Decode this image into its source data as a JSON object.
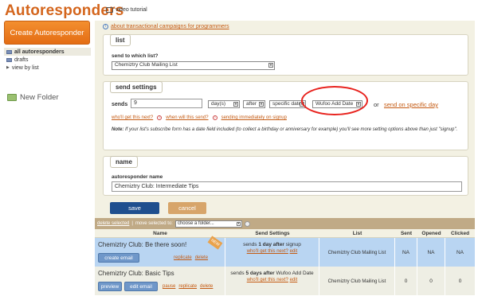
{
  "page": {
    "title": "Autoresponders",
    "video_tutorial": "video tutorial"
  },
  "sidebar": {
    "create_button": "Create Autoresponder",
    "items": [
      {
        "label": "all autoresponders"
      },
      {
        "label": "drafts"
      },
      {
        "label": "view by list"
      }
    ],
    "new_folder": "New Folder"
  },
  "main": {
    "info_link": "about transactional campaigns for programmers",
    "list_section": {
      "heading": "list",
      "field_label": "send to which list?",
      "selected_list": "Chemiztry Club Mailing List"
    },
    "send_settings": {
      "heading": "send settings",
      "sends_label": "sends",
      "sends_value": "9",
      "unit": "day(s)",
      "relation": "after",
      "anchor": "specific date",
      "date_field": "Wufoo Add Date",
      "or_text": "or",
      "specific_day_link": "send on specific day",
      "who_link": "who'll get this next?",
      "when_link": "when will this send?",
      "immediate_link": "sending immediately on signup",
      "note_label": "Note:",
      "note_text": "If your list's subscribe form has a date field included (to collect a birthday or anniversary for example) you'll see more setting options above than just \"signup\"."
    },
    "name_section": {
      "heading": "name",
      "field_label": "autoresponder name",
      "value": "Chemiztry Club: Intermediate Tips"
    },
    "save_label": "save",
    "cancel_label": "cancel"
  },
  "table": {
    "toolbar": {
      "delete_selected": "delete selected",
      "move_label": "move selected to:",
      "folder_select": "choose a folder..."
    },
    "columns": [
      "Name",
      "Send Settings",
      "List",
      "Sent",
      "Opened",
      "Clicked"
    ],
    "rows": [
      {
        "name": "Chemiztry Club: Be there soon!",
        "ribbon": "NEW",
        "primary_button": "create email",
        "links": [
          "replicate",
          "delete"
        ],
        "send_prefix": "sends",
        "send_bold": "1 day after",
        "send_suffix": "signup",
        "who_link": "who'll get this next?",
        "edit_link": "edit",
        "list": "Chemiztry Club Mailing List",
        "sent": "NA",
        "opened": "NA",
        "clicked": "NA"
      },
      {
        "name": "Chemiztry Club: Basic Tips",
        "preview_button": "preview",
        "primary_button": "edit email",
        "links": [
          "pause",
          "replicate",
          "delete"
        ],
        "send_prefix": "sends",
        "send_bold": "5 days after",
        "send_suffix": "Wufoo Add Date",
        "who_link": "who'll get this next?",
        "edit_link": "edit",
        "list": "Chemiztry Club Mailing List",
        "sent": "0",
        "opened": "0",
        "clicked": "0"
      }
    ]
  },
  "colors": {
    "brand_orange": "#d4651c",
    "save_blue": "#1f4f8e",
    "highlight_circle": "#e8231e",
    "selected_row": "#b9d5f2"
  }
}
